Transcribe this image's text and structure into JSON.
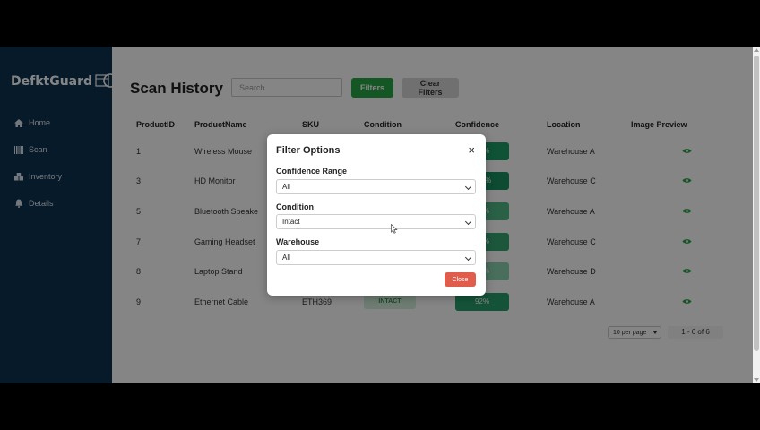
{
  "sidebar": {
    "logo": "DefktGuard",
    "items": [
      {
        "label": "Home",
        "icon": "home-icon"
      },
      {
        "label": "Scan",
        "icon": "barcode-icon"
      },
      {
        "label": "Inventory",
        "icon": "inventory-icon"
      },
      {
        "label": "Details",
        "icon": "bell-icon"
      }
    ]
  },
  "header": {
    "title": "Scan History",
    "search_placeholder": "Search",
    "filters_label": "Filters",
    "clear_label": "Clear Filters"
  },
  "table": {
    "columns": [
      "ProductID",
      "ProductName",
      "SKU",
      "Condition",
      "Confidence",
      "Location",
      "Image Preview"
    ],
    "rows": [
      {
        "id": "1",
        "name": "Wireless Mouse",
        "sku": "",
        "condition": "",
        "confidence": "98%",
        "location": "Warehouse A"
      },
      {
        "id": "3",
        "name": "HD Monitor",
        "sku": "",
        "condition": "",
        "confidence": "100%",
        "location": "Warehouse C"
      },
      {
        "id": "5",
        "name": "Bluetooth Speake",
        "sku": "",
        "condition": "",
        "confidence": "87%",
        "location": "Warehouse A"
      },
      {
        "id": "7",
        "name": "Gaming Headset",
        "sku": "",
        "condition": "",
        "confidence": "90%",
        "location": "Warehouse C"
      },
      {
        "id": "8",
        "name": "Laptop Stand",
        "sku": "",
        "condition": "",
        "confidence": "74%",
        "location": "Warehouse D"
      },
      {
        "id": "9",
        "name": "Ethernet Cable",
        "sku": "ETH369",
        "condition": "INTACT",
        "confidence": "92%",
        "location": "Warehouse A"
      }
    ]
  },
  "pagination": {
    "per_page": "10 per page",
    "range": "1 - 6 of 6"
  },
  "modal": {
    "title": "Filter Options",
    "close_x": "×",
    "confidence_label": "Confidence Range",
    "confidence_value": "All",
    "condition_label": "Condition",
    "condition_value": "Intact",
    "warehouse_label": "Warehouse",
    "warehouse_value": "All",
    "close_button": "Close"
  },
  "colors": {
    "sidebar": "#0c3352",
    "accent_green": "#28a745",
    "close_red": "#e05d4b"
  }
}
